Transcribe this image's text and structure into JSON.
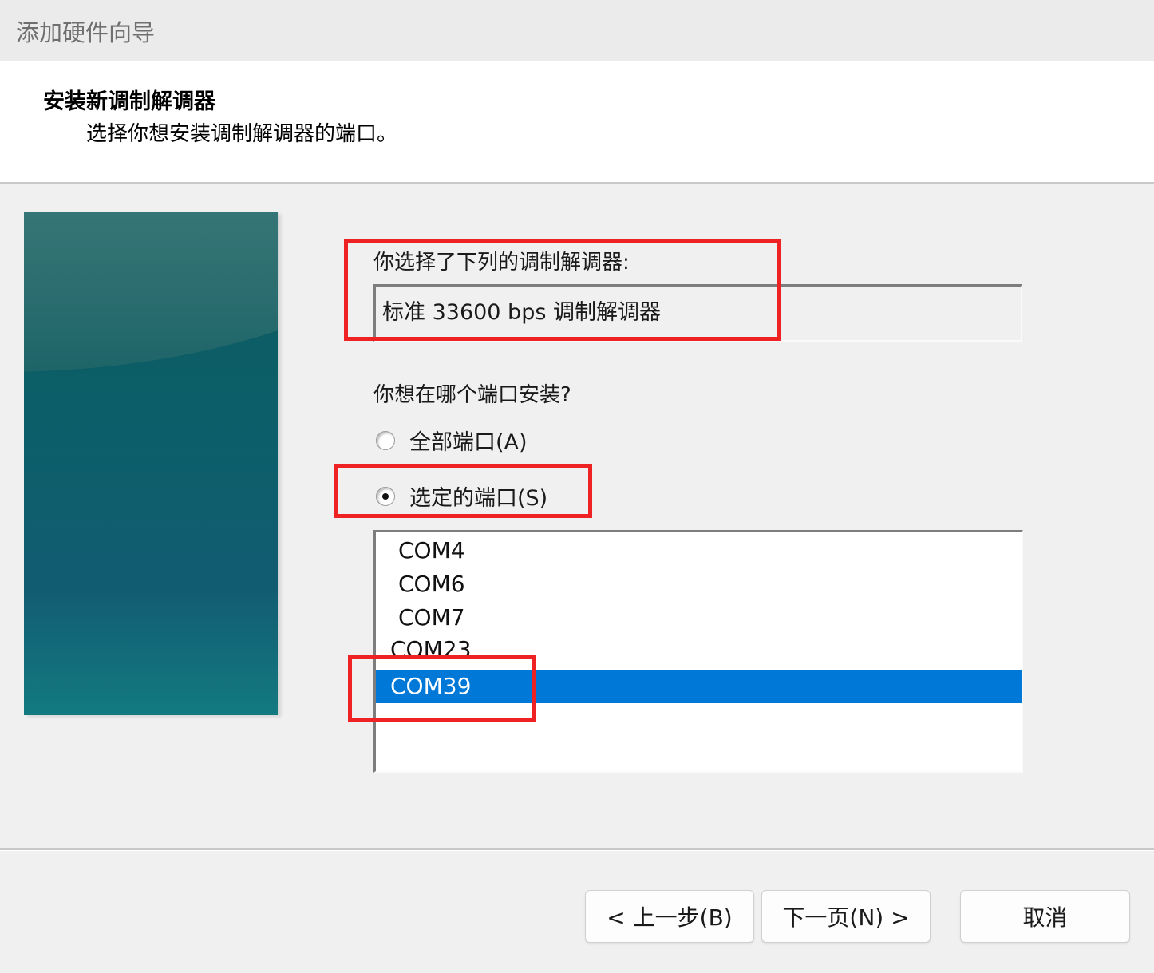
{
  "window": {
    "title": "添加硬件向导"
  },
  "header": {
    "title": "安装新调制解调器",
    "subtitle": "选择你想安装调制解调器的端口。"
  },
  "main": {
    "selected_modem_label": "你选择了下列的调制解调器:",
    "selected_modem_value": "标准 33600 bps 调制解调器",
    "port_question": "你想在哪个端口安装?",
    "radio_all": {
      "label": "全部端口(A)",
      "checked": false
    },
    "radio_selected": {
      "label": "选定的端口(S)",
      "checked": true
    },
    "ports": [
      "COM4",
      "COM6",
      "COM7",
      "COM23",
      "COM39"
    ],
    "selected_port": "COM39"
  },
  "footer": {
    "back_label": "< 上一步(B)",
    "next_label": "下一页(N) >",
    "cancel_label": "取消"
  },
  "colors": {
    "selection": "#0078d7",
    "highlight_annotation": "#ee2222"
  }
}
